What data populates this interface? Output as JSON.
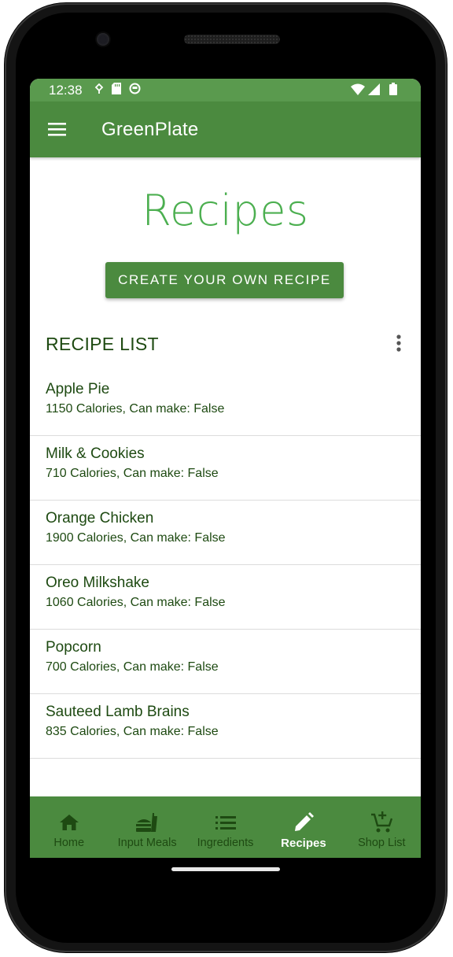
{
  "status_bar": {
    "time": "12:38"
  },
  "app_bar": {
    "title": "GreenPlate"
  },
  "page": {
    "title": "Recipes",
    "create_button": "CREATE YOUR OWN RECIPE",
    "list_header": "RECIPE LIST"
  },
  "recipes": [
    {
      "name": "Apple Pie",
      "detail": "1150 Calories, Can make: False"
    },
    {
      "name": "Milk & Cookies",
      "detail": "710 Calories, Can make: False"
    },
    {
      "name": "Orange Chicken",
      "detail": "1900 Calories, Can make: False"
    },
    {
      "name": "Oreo Milkshake",
      "detail": "1060 Calories, Can make: False"
    },
    {
      "name": "Popcorn",
      "detail": "700 Calories, Can make: False"
    },
    {
      "name": "Sauteed Lamb Brains",
      "detail": "835 Calories, Can make: False"
    }
  ],
  "bottom_nav": {
    "active": "Recipes",
    "items": [
      {
        "label": "Home",
        "icon": "home-icon"
      },
      {
        "label": "Input Meals",
        "icon": "fastfood-icon"
      },
      {
        "label": "Ingredients",
        "icon": "list-icon"
      },
      {
        "label": "Recipes",
        "icon": "pencil-icon"
      },
      {
        "label": "Shop List",
        "icon": "add-shopping-cart-icon"
      }
    ]
  },
  "colors": {
    "primary": "#4b8a3f",
    "status_bar": "#5a9a4e",
    "title_green": "#4caf50",
    "text_dark_green": "#1e4a12"
  }
}
